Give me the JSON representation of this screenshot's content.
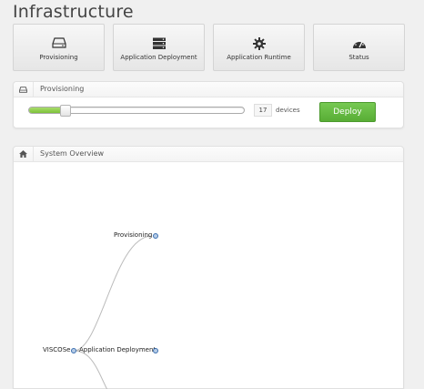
{
  "page": {
    "title": "Infrastructure"
  },
  "nav": [
    {
      "label": "Provisioning",
      "icon": "drive-icon"
    },
    {
      "label": "Application Deployment",
      "icon": "server-icon"
    },
    {
      "label": "Application Runtime",
      "icon": "gear-icon"
    },
    {
      "label": "Status",
      "icon": "dashboard-icon"
    }
  ],
  "provisioning": {
    "title": "Provisioning",
    "slider_fraction": 0.17,
    "count": "17",
    "unit": "devices",
    "deploy_label": "Deploy"
  },
  "overview": {
    "title": "System Overview",
    "nodes": {
      "root": "VISCOSe",
      "provisioning": "Provisioning",
      "deployment": "Application Deployment"
    }
  },
  "colors": {
    "accent_green": "#6cbd45",
    "node_blue": "#3b6fb0"
  }
}
